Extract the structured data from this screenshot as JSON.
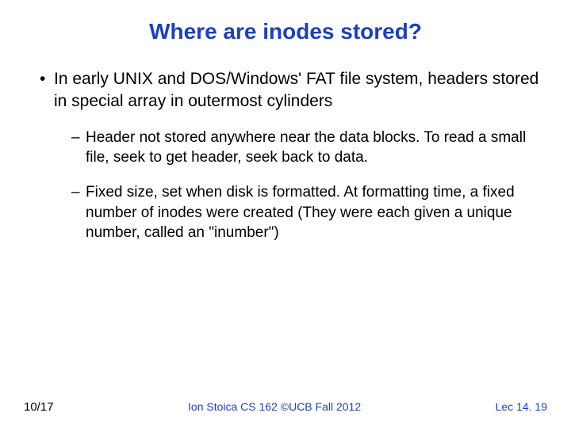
{
  "title": "Where are inodes stored?",
  "bullets": {
    "b1": "In early UNIX and DOS/Windows' FAT file system, headers stored in special array in outermost cylinders",
    "b1a": "Header not stored anywhere near the data blocks. To read a small file, seek to get header, seek back to data.",
    "b1b": "Fixed size, set when disk is formatted. At formatting time, a fixed number of inodes were created (They were each given a unique number, called an \"inumber\")"
  },
  "footer": {
    "left": "10/17",
    "center": "Ion Stoica CS 162 ©UCB Fall 2012",
    "right": "Lec 14. 19"
  }
}
